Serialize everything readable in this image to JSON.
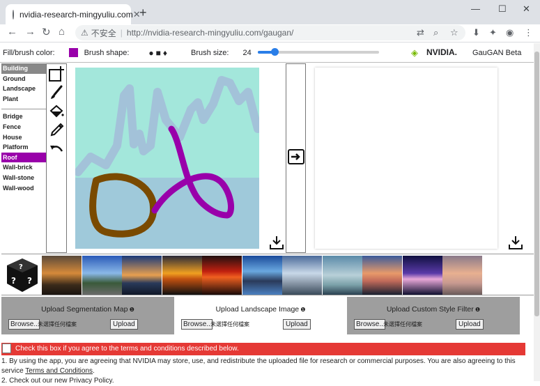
{
  "browser": {
    "tab_title": "nvidia-research-mingyuliu.com",
    "tab_close": "✕",
    "new_tab": "+",
    "win_min": "—",
    "win_max": "☐",
    "win_close": "✕",
    "security_label": "不安全",
    "url": "http://nvidia-research-mingyuliu.com/gaugan/"
  },
  "controls": {
    "fill_label": "Fill/brush color:",
    "fill_color": "#9900aa",
    "brush_shape_label": "Brush shape:",
    "brush_size_label": "Brush size:",
    "brush_size_value": "24",
    "brush_size_fraction": 0.14,
    "brand": "NVIDIA.",
    "app_name": "GauGAN Beta"
  },
  "labels": {
    "group1": [
      "Building",
      "Ground",
      "Landscape",
      "Plant"
    ],
    "group2": [
      "Bridge",
      "Fence",
      "House",
      "Platform",
      "Roof",
      "Wall-brick",
      "Wall-stone",
      "Wall-wood"
    ],
    "selected_primary": "Building",
    "selected_secondary": "Roof"
  },
  "tools": [
    "add-layer-icon",
    "brush-icon",
    "fill-bucket-icon",
    "eyedropper-icon",
    "undo-icon"
  ],
  "canvas": {
    "sky_color": "#a3e7db",
    "water_color": "#9fc9da",
    "stroke_blue": "#a3c2d9",
    "stroke_brown": "#7a4a00",
    "stroke_purple": "#9900aa"
  },
  "uploads": [
    {
      "title": "Upload Segmentation Map",
      "browse": "Browse..",
      "none": "未選擇任何檔案",
      "button": "Upload"
    },
    {
      "title": "Upload Landscape Image",
      "browse": "Browse..",
      "none": "未選擇任何檔案",
      "button": "Upload"
    },
    {
      "title": "Upload Custom Style Filter",
      "browse": "Browse..",
      "none": "未選擇任何檔案",
      "button": "Upload"
    }
  ],
  "terms": {
    "checkbox_text": "Check this box if you agree to the terms and conditions described below.",
    "line1": "1. By using the app, you are agreeing that NVIDIA may store, use, and redistribute the uploaded file for research or commercial purposes. You are also agreeing to this service",
    "line1_link": "Terms and Conditions",
    "line1_end": ".",
    "line2": "2. Check out our new Privacy Policy."
  }
}
